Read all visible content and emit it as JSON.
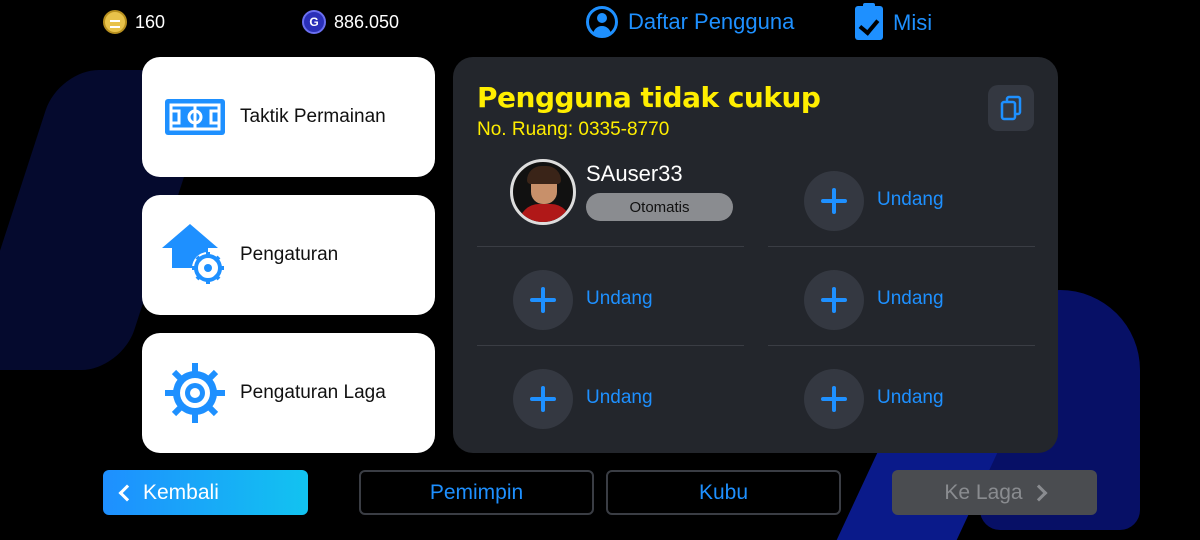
{
  "topbar": {
    "coins": "160",
    "gp": "886.050",
    "gp_icon_letter": "G",
    "user_list_label": "Daftar Pengguna",
    "missions_label": "Misi"
  },
  "left_menu": {
    "items": [
      {
        "label": "Taktik Permainan",
        "icon": "tactics-field-icon"
      },
      {
        "label": "Pengaturan",
        "icon": "settings-house-gear-icon"
      },
      {
        "label": "Pengaturan Laga",
        "icon": "match-settings-gear-icon"
      }
    ]
  },
  "room": {
    "title": "Pengguna tidak cukup",
    "room_no": "No. Ruang: 0335-8770",
    "host": {
      "name": "SAuser33",
      "status": "Otomatis"
    },
    "invite_label": "Undang"
  },
  "bottom": {
    "back_label": "Kembali",
    "leader_label": "Pemimpin",
    "club_label": "Kubu",
    "next_label": "Ke Laga"
  },
  "colors": {
    "accent_blue": "#1e90ff",
    "title_yellow": "#ffee00",
    "panel_bg": "#23262c",
    "disabled_gray": "#4a4c50"
  }
}
